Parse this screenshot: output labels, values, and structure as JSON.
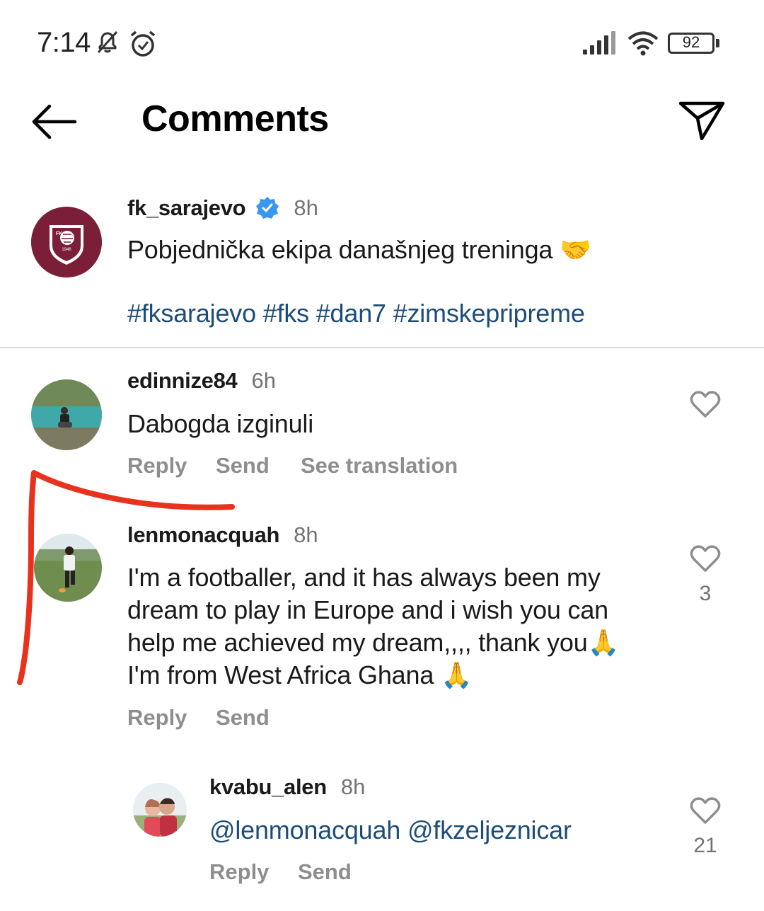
{
  "status_bar": {
    "time": "7:14",
    "battery": "92",
    "icons": [
      "bell-off-icon",
      "alarm-icon",
      "signal-icon",
      "wifi-icon",
      "battery-icon"
    ]
  },
  "header": {
    "title": "Comments",
    "back_icon": "arrow-left-icon",
    "share_icon": "paper-plane-icon"
  },
  "caption": {
    "username": "fk_sarajevo",
    "verified": true,
    "time": "8h",
    "text": "Pobjednička ekipa današnjeg treninga 🤝",
    "hashtags": "#fksarajevo #fks #dan7 #zimskepripreme",
    "logo_text": "FK SARAJEVO 1946"
  },
  "comments": [
    {
      "username": "edinnize84",
      "time": "6h",
      "lines": [
        "Dabogda izginuli"
      ],
      "actions": [
        "Reply",
        "Send",
        "See translation"
      ],
      "likes": ""
    },
    {
      "username": "lenmonacquah",
      "time": "8h",
      "lines": [
        "I'm a footballer, and it has always been my",
        "dream to play in Europe and i wish you can",
        "help me achieved my dream,,,, thank you🙏",
        "I'm from West Africa Ghana 🙏"
      ],
      "actions": [
        "Reply",
        "Send"
      ],
      "likes": "3"
    }
  ],
  "reply": {
    "username": "kvabu_alen",
    "time": "8h",
    "mention_1": "@lenmonacquah",
    "mention_2": "@fkzeljeznicar",
    "actions": [
      "Reply",
      "Send"
    ],
    "likes": "21"
  },
  "colors": {
    "link": "#1c4d7a",
    "muted": "#8e8e8e",
    "annotation": "#e8321e",
    "verified": "#3897f0",
    "club": "#7b1f38"
  }
}
